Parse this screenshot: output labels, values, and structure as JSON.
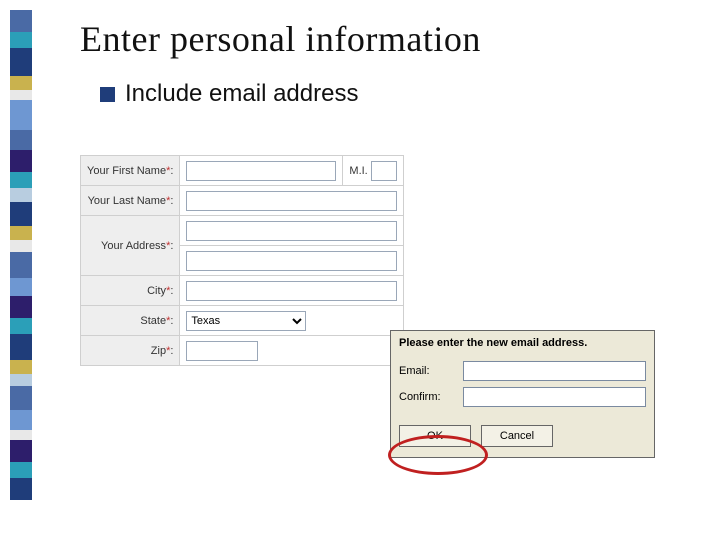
{
  "heading": "Enter personal information",
  "bullet": "Include email address",
  "form": {
    "first_name_label": "Your First Name",
    "mi_label": "M.I.",
    "last_name_label": "Your Last Name",
    "address_label": "Your Address",
    "city_label": "City",
    "state_label": "State",
    "zip_label": "Zip",
    "asterisk": "*",
    "colon": ":",
    "state_value": "Texas"
  },
  "dialog": {
    "title": "Please enter the new email address.",
    "email_label": "Email:",
    "confirm_label": "Confirm:",
    "ok": "OK",
    "cancel": "Cancel"
  }
}
